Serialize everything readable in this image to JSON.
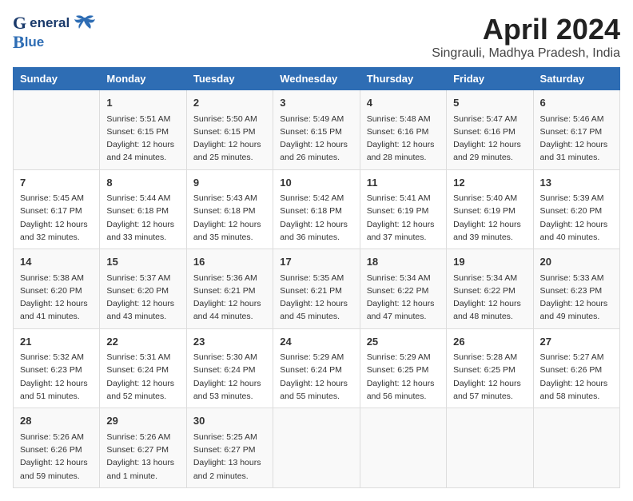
{
  "header": {
    "logo_line1": "General",
    "logo_line2": "Blue",
    "title": "April 2024",
    "subtitle": "Singrauli, Madhya Pradesh, India"
  },
  "days_of_week": [
    "Sunday",
    "Monday",
    "Tuesday",
    "Wednesday",
    "Thursday",
    "Friday",
    "Saturday"
  ],
  "weeks": [
    [
      {
        "day": "",
        "info": ""
      },
      {
        "day": "1",
        "info": "Sunrise: 5:51 AM\nSunset: 6:15 PM\nDaylight: 12 hours\nand 24 minutes."
      },
      {
        "day": "2",
        "info": "Sunrise: 5:50 AM\nSunset: 6:15 PM\nDaylight: 12 hours\nand 25 minutes."
      },
      {
        "day": "3",
        "info": "Sunrise: 5:49 AM\nSunset: 6:15 PM\nDaylight: 12 hours\nand 26 minutes."
      },
      {
        "day": "4",
        "info": "Sunrise: 5:48 AM\nSunset: 6:16 PM\nDaylight: 12 hours\nand 28 minutes."
      },
      {
        "day": "5",
        "info": "Sunrise: 5:47 AM\nSunset: 6:16 PM\nDaylight: 12 hours\nand 29 minutes."
      },
      {
        "day": "6",
        "info": "Sunrise: 5:46 AM\nSunset: 6:17 PM\nDaylight: 12 hours\nand 31 minutes."
      }
    ],
    [
      {
        "day": "7",
        "info": "Sunrise: 5:45 AM\nSunset: 6:17 PM\nDaylight: 12 hours\nand 32 minutes."
      },
      {
        "day": "8",
        "info": "Sunrise: 5:44 AM\nSunset: 6:18 PM\nDaylight: 12 hours\nand 33 minutes."
      },
      {
        "day": "9",
        "info": "Sunrise: 5:43 AM\nSunset: 6:18 PM\nDaylight: 12 hours\nand 35 minutes."
      },
      {
        "day": "10",
        "info": "Sunrise: 5:42 AM\nSunset: 6:18 PM\nDaylight: 12 hours\nand 36 minutes."
      },
      {
        "day": "11",
        "info": "Sunrise: 5:41 AM\nSunset: 6:19 PM\nDaylight: 12 hours\nand 37 minutes."
      },
      {
        "day": "12",
        "info": "Sunrise: 5:40 AM\nSunset: 6:19 PM\nDaylight: 12 hours\nand 39 minutes."
      },
      {
        "day": "13",
        "info": "Sunrise: 5:39 AM\nSunset: 6:20 PM\nDaylight: 12 hours\nand 40 minutes."
      }
    ],
    [
      {
        "day": "14",
        "info": "Sunrise: 5:38 AM\nSunset: 6:20 PM\nDaylight: 12 hours\nand 41 minutes."
      },
      {
        "day": "15",
        "info": "Sunrise: 5:37 AM\nSunset: 6:20 PM\nDaylight: 12 hours\nand 43 minutes."
      },
      {
        "day": "16",
        "info": "Sunrise: 5:36 AM\nSunset: 6:21 PM\nDaylight: 12 hours\nand 44 minutes."
      },
      {
        "day": "17",
        "info": "Sunrise: 5:35 AM\nSunset: 6:21 PM\nDaylight: 12 hours\nand 45 minutes."
      },
      {
        "day": "18",
        "info": "Sunrise: 5:34 AM\nSunset: 6:22 PM\nDaylight: 12 hours\nand 47 minutes."
      },
      {
        "day": "19",
        "info": "Sunrise: 5:34 AM\nSunset: 6:22 PM\nDaylight: 12 hours\nand 48 minutes."
      },
      {
        "day": "20",
        "info": "Sunrise: 5:33 AM\nSunset: 6:23 PM\nDaylight: 12 hours\nand 49 minutes."
      }
    ],
    [
      {
        "day": "21",
        "info": "Sunrise: 5:32 AM\nSunset: 6:23 PM\nDaylight: 12 hours\nand 51 minutes."
      },
      {
        "day": "22",
        "info": "Sunrise: 5:31 AM\nSunset: 6:24 PM\nDaylight: 12 hours\nand 52 minutes."
      },
      {
        "day": "23",
        "info": "Sunrise: 5:30 AM\nSunset: 6:24 PM\nDaylight: 12 hours\nand 53 minutes."
      },
      {
        "day": "24",
        "info": "Sunrise: 5:29 AM\nSunset: 6:24 PM\nDaylight: 12 hours\nand 55 minutes."
      },
      {
        "day": "25",
        "info": "Sunrise: 5:29 AM\nSunset: 6:25 PM\nDaylight: 12 hours\nand 56 minutes."
      },
      {
        "day": "26",
        "info": "Sunrise: 5:28 AM\nSunset: 6:25 PM\nDaylight: 12 hours\nand 57 minutes."
      },
      {
        "day": "27",
        "info": "Sunrise: 5:27 AM\nSunset: 6:26 PM\nDaylight: 12 hours\nand 58 minutes."
      }
    ],
    [
      {
        "day": "28",
        "info": "Sunrise: 5:26 AM\nSunset: 6:26 PM\nDaylight: 12 hours\nand 59 minutes."
      },
      {
        "day": "29",
        "info": "Sunrise: 5:26 AM\nSunset: 6:27 PM\nDaylight: 13 hours\nand 1 minute."
      },
      {
        "day": "30",
        "info": "Sunrise: 5:25 AM\nSunset: 6:27 PM\nDaylight: 13 hours\nand 2 minutes."
      },
      {
        "day": "",
        "info": ""
      },
      {
        "day": "",
        "info": ""
      },
      {
        "day": "",
        "info": ""
      },
      {
        "day": "",
        "info": ""
      }
    ]
  ]
}
